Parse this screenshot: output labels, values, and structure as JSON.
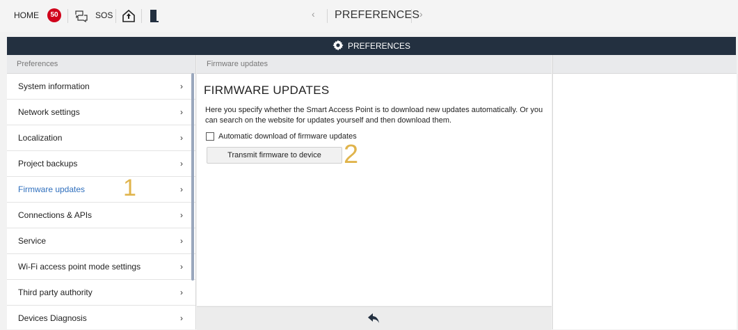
{
  "topbar": {
    "home_label": "HOME",
    "badge_count": "50",
    "sos_label": "SOS",
    "nav_left": "‹",
    "title": "PREFERENCES",
    "nav_right": "›"
  },
  "header": {
    "title": "PREFERENCES"
  },
  "sidebar": {
    "heading": "Preferences",
    "items": [
      {
        "label": "System information"
      },
      {
        "label": "Network settings"
      },
      {
        "label": "Localization"
      },
      {
        "label": "Project backups"
      },
      {
        "label": "Firmware updates",
        "marker": "1"
      },
      {
        "label": "Connections & APIs"
      },
      {
        "label": "Service"
      },
      {
        "label": "Wi-Fi access point mode settings"
      },
      {
        "label": "Third party authority"
      },
      {
        "label": "Devices Diagnosis"
      }
    ],
    "chevron": "›"
  },
  "main": {
    "breadcrumb": "Firmware updates",
    "title": "FIRMWARE UPDATES",
    "description": "Here you specify whether the Smart Access Point is to download new updates automatically. Or you can search on the website for updates yourself and then download them.",
    "checkbox_label": "Automatic download of firmware updates",
    "button_label": "Transmit firmware to device",
    "button_marker": "2"
  },
  "colors": {
    "header_bg": "#233040",
    "badge": "#d0021b",
    "selected_text": "#2f6fbd",
    "marker": "#e0b44c"
  }
}
